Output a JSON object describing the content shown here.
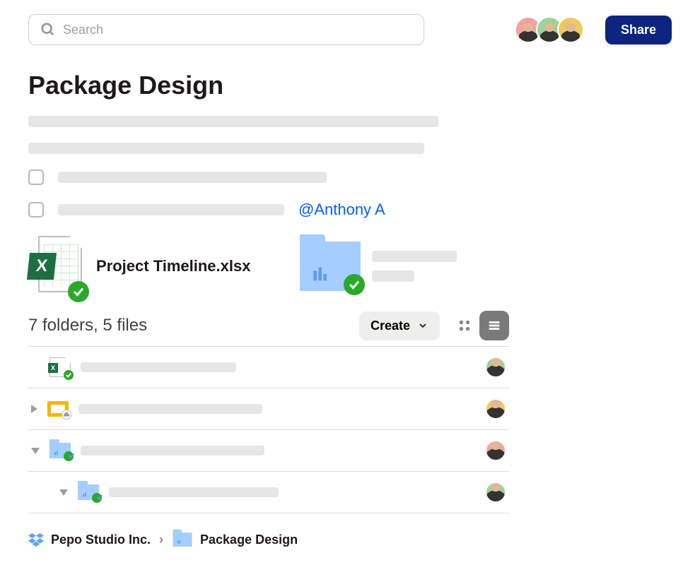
{
  "search": {
    "placeholder": "Search"
  },
  "share_label": "Share",
  "avatars": [
    {
      "color": "pink"
    },
    {
      "color": "green"
    },
    {
      "color": "yellow"
    }
  ],
  "page_title": "Package Design",
  "mention": "@Anthony A",
  "card1": {
    "title": "Project Timeline.xlsx",
    "x_label": "X"
  },
  "summary": {
    "text": "7 folders, 5 files",
    "create_label": "Create"
  },
  "breadcrumbs": {
    "item1": "Pepo Studio Inc.",
    "item2": "Package Design",
    "sep": "›"
  },
  "file_rows": [
    {
      "type": "excel",
      "avatar_color": "green",
      "expander": null,
      "synced": true
    },
    {
      "type": "slides",
      "avatar_color": "yellow",
      "expander": "right",
      "synced": false
    },
    {
      "type": "folder",
      "avatar_color": "pink",
      "expander": "down",
      "synced": true
    },
    {
      "type": "folder",
      "avatar_color": "green",
      "expander": "down",
      "synced": true,
      "indent": true
    }
  ]
}
